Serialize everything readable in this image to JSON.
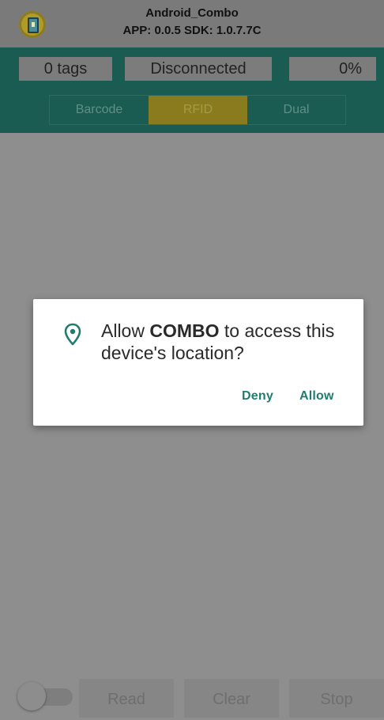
{
  "titlebar": {
    "app_name": "Android_Combo",
    "version_line": "APP: 0.0.5 SDK: 1.0.7.7C",
    "icon": "app-phone-icon"
  },
  "status": {
    "tags": "0 tags",
    "connection": "Disconnected",
    "percent": "0%"
  },
  "modes": {
    "barcode": "Barcode",
    "rfid": "RFID",
    "dual": "Dual",
    "selected": "RFID"
  },
  "dialog": {
    "icon": "location-pin-icon",
    "prefix": "Allow ",
    "app": "COMBO",
    "suffix": " to access this device's location?",
    "deny": "Deny",
    "allow": "Allow"
  },
  "bottom": {
    "toggle_on": false,
    "read": "Read",
    "clear": "Clear",
    "stop": "Stop"
  },
  "colors": {
    "accent": "#217c70",
    "teal_bar": "#1b5c52",
    "rfid_selected": "#8a7c1e",
    "scrim": "#8e8e8e"
  }
}
